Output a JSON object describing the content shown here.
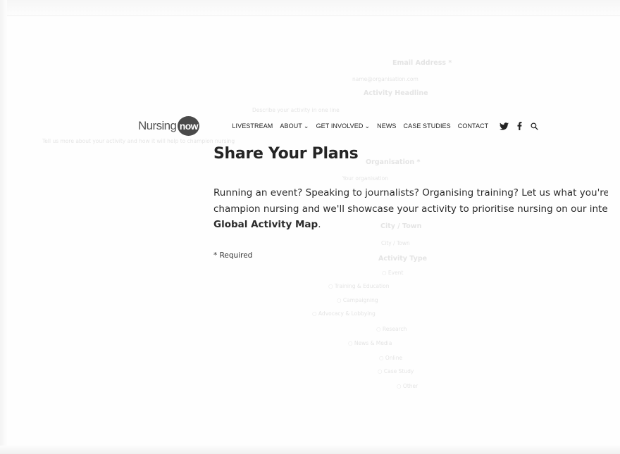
{
  "header": {
    "logo_text": "Nursing",
    "logo_badge": "now",
    "nav": [
      {
        "label": "LIVESTREAM",
        "has_dropdown": false
      },
      {
        "label": "ABOUT",
        "has_dropdown": true
      },
      {
        "label": "GET INVOLVED",
        "has_dropdown": true
      },
      {
        "label": "NEWS",
        "has_dropdown": false
      },
      {
        "label": "CASE STUDIES",
        "has_dropdown": false
      },
      {
        "label": "CONTACT",
        "has_dropdown": false
      }
    ],
    "icons": [
      "twitter-icon",
      "facebook-icon",
      "search-icon"
    ]
  },
  "main": {
    "title": "Share Your Plans",
    "intro_line1": "Running an event? Speaking to journalists? Organising training? Let us what you're d",
    "intro_line2": "champion nursing and we'll showcase your activity to prioritise nursing on our intera",
    "intro_link": "Global Activity Map",
    "intro_end": ".",
    "required_note": "* Required"
  },
  "colors": {
    "text": "#222222",
    "logo_badge": "#4a4a4a",
    "ghost_text": "#e4e4e4"
  }
}
